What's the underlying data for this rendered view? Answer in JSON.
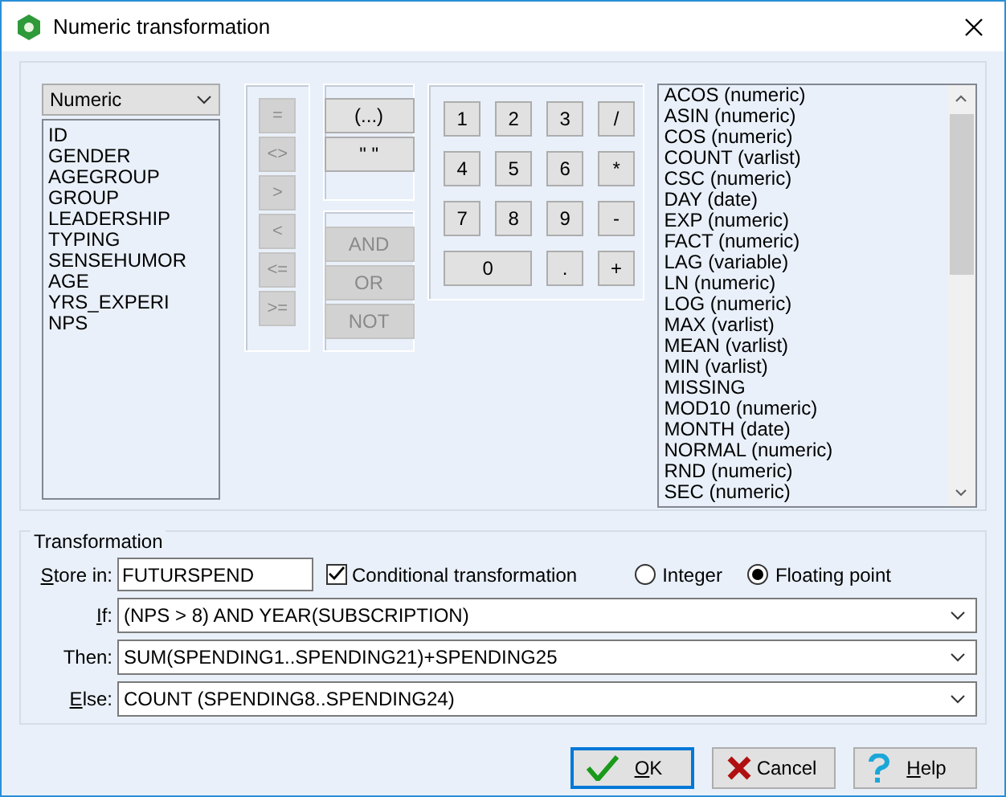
{
  "window": {
    "title": "Numeric transformation"
  },
  "variable_type": {
    "value": "Numeric"
  },
  "variables": [
    "ID",
    "GENDER",
    "AGEGROUP",
    "GROUP",
    "LEADERSHIP",
    "TYPING",
    "SENSEHUMOR",
    "AGE",
    "YRS_EXPERI",
    "NPS"
  ],
  "operators": [
    {
      "label": "=",
      "disabled": true
    },
    {
      "label": "<>",
      "disabled": true
    },
    {
      "label": ">",
      "disabled": true
    },
    {
      "label": "<",
      "disabled": true
    },
    {
      "label": "<=",
      "disabled": true
    },
    {
      "label": ">=",
      "disabled": true
    }
  ],
  "grouping_buttons": [
    {
      "label": "(...)",
      "disabled": false
    },
    {
      "label": "\" \"",
      "disabled": false
    }
  ],
  "logic_buttons": [
    {
      "label": "AND",
      "disabled": true
    },
    {
      "label": "OR",
      "disabled": true
    },
    {
      "label": "NOT",
      "disabled": true
    }
  ],
  "keypad": [
    {
      "label": "1",
      "kind": "key"
    },
    {
      "label": "2",
      "kind": "key"
    },
    {
      "label": "3",
      "kind": "key"
    },
    {
      "label": "/",
      "kind": "key"
    },
    {
      "label": "4",
      "kind": "key"
    },
    {
      "label": "5",
      "kind": "key"
    },
    {
      "label": "6",
      "kind": "key"
    },
    {
      "label": "*",
      "kind": "key"
    },
    {
      "label": "7",
      "kind": "key"
    },
    {
      "label": "8",
      "kind": "key"
    },
    {
      "label": "9",
      "kind": "key"
    },
    {
      "label": "-",
      "kind": "key"
    },
    {
      "label": "0",
      "kind": "wide"
    },
    {
      "label": ".",
      "kind": "key"
    },
    {
      "label": "+",
      "kind": "key"
    }
  ],
  "functions": [
    "ACOS (numeric)",
    "ASIN (numeric)",
    "COS (numeric)",
    "COUNT (varlist)",
    "CSC (numeric)",
    "DAY (date)",
    "EXP (numeric)",
    "FACT (numeric)",
    "LAG (variable)",
    "LN (numeric)",
    "LOG (numeric)",
    "MAX (varlist)",
    "MEAN (varlist)",
    "MIN (varlist)",
    "MISSING",
    "MOD10 (numeric)",
    "MONTH (date)",
    "NORMAL (numeric)",
    "RND (numeric)",
    "SEC (numeric)"
  ],
  "transformation": {
    "title": "Transformation",
    "store_label": {
      "text": "Store in:",
      "mnemonic": true
    },
    "store_value": "FUTURSPEND",
    "conditional": {
      "label": "Conditional transformation",
      "checked": true
    },
    "number_type": [
      {
        "label": "Integer",
        "selected": false
      },
      {
        "label": "Floating point",
        "selected": true
      }
    ],
    "expressions": [
      {
        "label": "If:",
        "mnemonic": true,
        "value": "(NPS > 8) AND YEAR(SUBSCRIPTION)"
      },
      {
        "label": "Then:",
        "mnemonic": false,
        "value": "SUM(SPENDING1..SPENDING21)+SPENDING25"
      },
      {
        "label": "Else:",
        "mnemonic": true,
        "value": "COUNT (SPENDING8..SPENDING24)"
      }
    ]
  },
  "buttons": [
    {
      "label": "OK",
      "kind": "ok",
      "default": true,
      "mnemonic": true
    },
    {
      "label": "Cancel",
      "kind": "cancel",
      "default": false,
      "mnemonic": false
    },
    {
      "label": "Help",
      "kind": "help",
      "default": false,
      "mnemonic": true
    }
  ]
}
